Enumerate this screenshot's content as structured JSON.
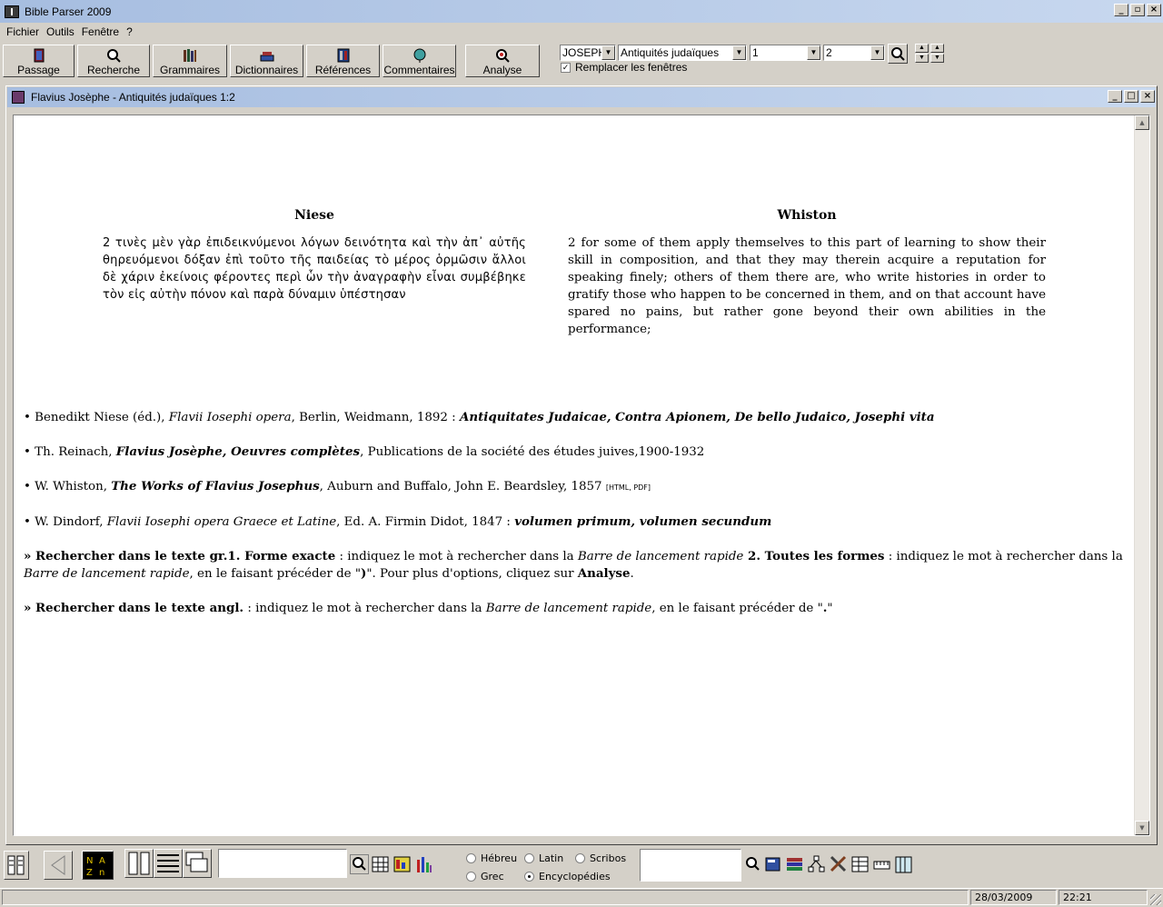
{
  "app": {
    "title": "Bible Parser 2009"
  },
  "menu": {
    "items": [
      {
        "label": "Fichier"
      },
      {
        "label": "Outils"
      },
      {
        "label": "Fenêtre"
      },
      {
        "label": "?"
      }
    ]
  },
  "toolbar": {
    "buttons": [
      {
        "label": "Passage",
        "icon": "book-icon"
      },
      {
        "label": "Recherche",
        "icon": "search-icon"
      },
      {
        "label": "Grammaires",
        "icon": "books-icon"
      },
      {
        "label": "Dictionnaires",
        "icon": "dictionary-icon"
      },
      {
        "label": "Références",
        "icon": "references-icon"
      },
      {
        "label": "Commentaires",
        "icon": "globe-icon"
      },
      {
        "label": "Analyse",
        "icon": "analysis-icon"
      }
    ],
    "source_select": "JOSEPH",
    "work_select": "Antiquités judaïques",
    "chapter_select": "1",
    "verse_select": "2",
    "replace_windows_label": "Remplacer les fenêtres",
    "replace_windows_checked": true
  },
  "document": {
    "title": "Flavius Josèphe - Antiquités judaïques 1:2",
    "left_column_title": "Niese",
    "left_column_text": "2 τινὲς μὲν γὰρ ἐπιδεικνύμενοι λόγων δεινότητα καὶ τὴν ἀπ᾽ αὐτῆς θηρευόμενοι δόξαν ἐπὶ τοῦτο τῆς παιδείας τὸ μέρος ὁρμῶσιν ἄλλοι δὲ χάριν ἐκείνοις φέροντες περὶ ὧν τὴν ἀναγραφὴν εἶναι συμβέβηκε τὸν εἰς αὐτὴν πόνον καὶ παρὰ δύναμιν ὑπέστησαν",
    "right_column_title": "Whiston",
    "right_column_text": "2 for some of them apply themselves to this part of learning to show their skill in composition, and that they may therein acquire a reputation for speaking finely; others of them there are, who write histories in order to gratify those who happen to be concerned in them, and on that account have spared no pains, but rather gone beyond their own abilities in the performance;",
    "refs": {
      "r1_a": "• Benedikt Niese (éd.), ",
      "r1_b": "Flavii Iosephi opera",
      "r1_c": ", Berlin, Weidmann, 1892 : ",
      "r1_d": "Antiquitates Judaicae, Contra Apionem, De bello Judaico, Josephi vita",
      "r2_a": "• Th. Reinach, ",
      "r2_b": "Flavius Josèphe, Oeuvres complètes",
      "r2_c": ", Publications de la société des études juives,1900-1932",
      "r3_a": "• W. Whiston, ",
      "r3_b": "The Works of Flavius Josephus",
      "r3_c": ", Auburn and Buffalo, John E. Beardsley, 1857 ",
      "r3_d": "[HTML, PDF]",
      "r4_a": "• W. Dindorf, ",
      "r4_b": "Flavii Iosephi opera Graece et Latine",
      "r4_c": ", Ed. A. Firmin Didot, 1847 : ",
      "r4_d": "volumen primum, volumen secundum"
    },
    "help": {
      "h1_a": "» Rechercher dans le texte gr.",
      "h1_b": "1. Forme exacte",
      "h1_c": " : indiquez le mot à rechercher dans la ",
      "h1_d": "Barre de lancement rapide",
      "h1_e": " 2. Toutes les formes",
      "h1_f": " : indiquez le mot à rechercher dans la ",
      "h1_g": "Barre de lancement rapide",
      "h1_h": ", en le faisant précéder de \"",
      "h1_i": ")",
      "h1_j": "\". Pour plus d'options, cliquez sur ",
      "h1_k": "Analyse",
      "h1_l": ".",
      "h2_a": "» Rechercher dans le texte angl.",
      "h2_b": " : indiquez le mot à rechercher dans la ",
      "h2_c": "Barre de lancement rapide",
      "h2_d": ", en le faisant précéder de \"",
      "h2_e": ".",
      "h2_f": "\""
    }
  },
  "bottom": {
    "radios": [
      {
        "label": "Hébreu",
        "checked": false
      },
      {
        "label": "Latin",
        "checked": false
      },
      {
        "label": "Scribos",
        "checked": false
      },
      {
        "label": "Grec",
        "checked": false
      },
      {
        "label": "Encyclopédies",
        "checked": true
      }
    ]
  },
  "status": {
    "date": "28/03/2009",
    "time": "22:21"
  }
}
